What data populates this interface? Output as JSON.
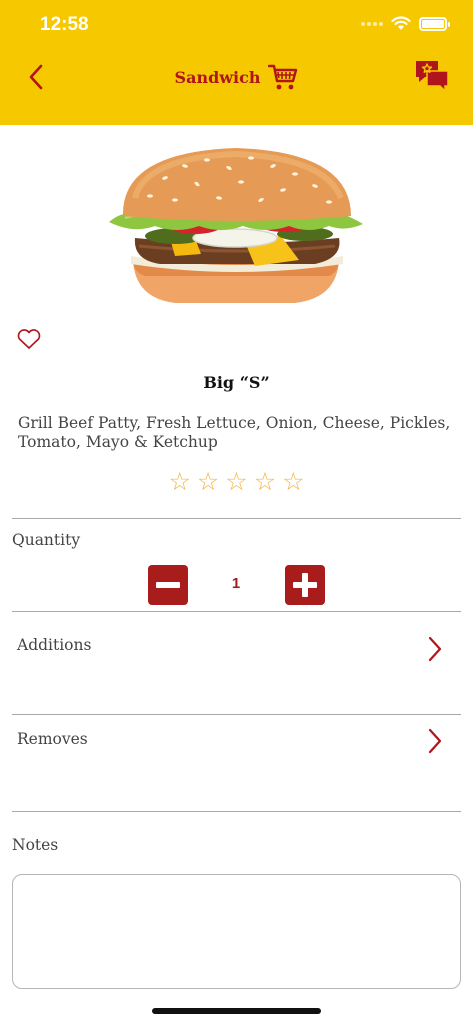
{
  "status_bar": {
    "time": "12:58"
  },
  "nav": {
    "title": "Sandwich",
    "back_icon": "chevron-left-icon",
    "cart_icon": "cart-icon",
    "chat_icon": "chat-star-icon"
  },
  "item": {
    "image": "burger-image",
    "name": "Big “S”",
    "description": "Grill Beef Patty, Fresh Lettuce, Onion, Cheese, Pickles, Tomato, Mayo & Ketchup",
    "rating": 0,
    "rating_max": 5,
    "stars": [
      "☆",
      "☆",
      "☆",
      "☆",
      "☆"
    ]
  },
  "quantity": {
    "label": "Quantity",
    "value": "1"
  },
  "additions": {
    "label": "Additions"
  },
  "removes": {
    "label": "Removes"
  },
  "notes": {
    "label": "Notes",
    "value": ""
  },
  "colors": {
    "header_bg": "#f5c800",
    "brand_red": "#b0151b",
    "button_red": "#a81c1c",
    "star": "#f2b544"
  }
}
